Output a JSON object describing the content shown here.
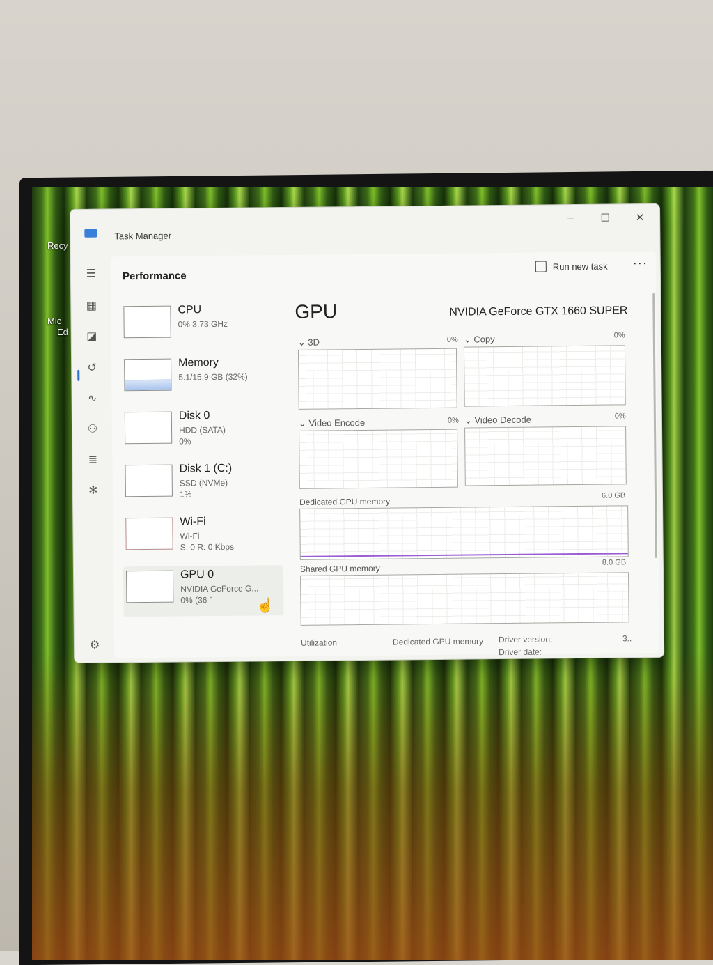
{
  "window": {
    "title": "Task Manager"
  },
  "desktop_icons": [
    "Recy",
    "Mic",
    "Ed"
  ],
  "header": {
    "section": "Performance",
    "run_new_task": "Run new task",
    "more": "···"
  },
  "devices": [
    {
      "name": "CPU",
      "line2": "0% 3.73 GHz",
      "line3": ""
    },
    {
      "name": "Memory",
      "line2": "5.1/15.9 GB (32%)",
      "line3": "",
      "fill": 0.32
    },
    {
      "name": "Disk 0",
      "line2": "HDD (SATA)",
      "line3": "0%"
    },
    {
      "name": "Disk 1 (C:)",
      "line2": "SSD (NVMe)",
      "line3": "1%"
    },
    {
      "name": "Wi-Fi",
      "line2": "Wi-Fi",
      "line3": "S: 0 R: 0 Kbps"
    },
    {
      "name": "GPU 0",
      "line2": "NVIDIA GeForce G...",
      "line3": "0% (36 °",
      "selected": true
    }
  ],
  "gpu": {
    "heading": "GPU",
    "model": "NVIDIA GeForce GTX 1660 SUPER",
    "engines": [
      {
        "label": "3D",
        "value": "0%"
      },
      {
        "label": "Copy",
        "value": "0%"
      },
      {
        "label": "Video Encode",
        "value": "0%"
      },
      {
        "label": "Video Decode",
        "value": "0%"
      }
    ],
    "dedicated": {
      "label": "Dedicated GPU memory",
      "max": "6.0 GB"
    },
    "shared": {
      "label": "Shared GPU memory",
      "max": "8.0 GB"
    },
    "footer": {
      "utilization": "Utilization",
      "dedicated_mem": "Dedicated GPU memory",
      "driver_version": "Driver version:",
      "driver_version_value": "3..",
      "driver_date": "Driver date:"
    }
  }
}
